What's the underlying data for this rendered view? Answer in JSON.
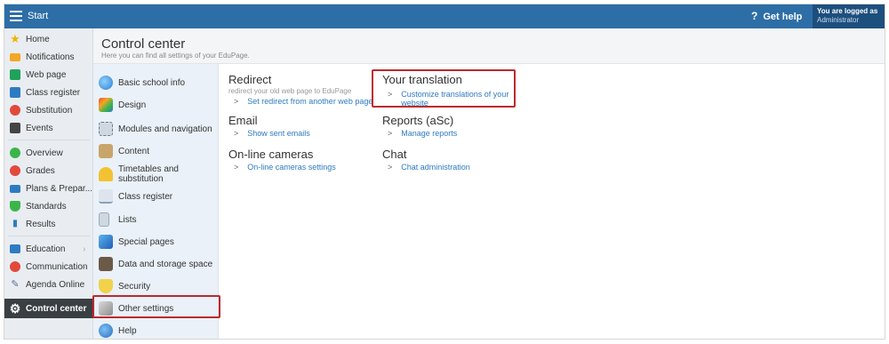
{
  "topbar": {
    "start_label": "Start",
    "help_label": "Get help",
    "help_icon": "?",
    "user_line1": "You are logged as",
    "user_line2": "Administrator"
  },
  "leftnav": {
    "items": [
      {
        "label": "Home",
        "icon": "star-icon",
        "color": "#f0b400"
      },
      {
        "label": "Notifications",
        "icon": "envelope-icon",
        "color": "#f5a623"
      },
      {
        "label": "Web page",
        "icon": "house-icon",
        "color": "#1ea35a"
      },
      {
        "label": "Class register",
        "icon": "book-icon",
        "color": "#2d7cc3"
      },
      {
        "label": "Substitution",
        "icon": "person-icon",
        "color": "#e04a3a"
      },
      {
        "label": "Events",
        "icon": "calendar-icon",
        "color": "#444444"
      },
      {
        "label": "Overview",
        "icon": "circle-icon",
        "color": "#3bb54a"
      },
      {
        "label": "Grades",
        "icon": "circle-icon",
        "color": "#e2493b"
      },
      {
        "label": "Plans & Prepar...",
        "icon": "folder-icon",
        "color": "#2d7cc3"
      },
      {
        "label": "Standards",
        "icon": "shield-icon",
        "color": "#3bb54a"
      },
      {
        "label": "Results",
        "icon": "bar-chart-icon",
        "color": "#2d7cc3"
      },
      {
        "label": "Education",
        "icon": "briefcase-icon",
        "color": "#2d7cc3"
      },
      {
        "label": "Communication",
        "icon": "chat-icon",
        "color": "#e2493b"
      },
      {
        "label": "Agenda Online",
        "icon": "pen-icon",
        "color": "#5a6f9a"
      },
      {
        "label": "Control center",
        "icon": "gear-icon",
        "color": "#ffffff"
      }
    ]
  },
  "header": {
    "title": "Control center",
    "subtitle": "Here you can find all settings of your EduPage."
  },
  "settings": {
    "items": [
      {
        "label": "Basic school info",
        "icon": "globe-icon"
      },
      {
        "label": "Design",
        "icon": "palette-icon"
      },
      {
        "label": "Modules and navigation",
        "icon": "modules-icon"
      },
      {
        "label": "Content",
        "icon": "content-icon"
      },
      {
        "label": "Timetables and substitution",
        "icon": "bell-icon"
      },
      {
        "label": "Class register",
        "icon": "notebook-icon"
      },
      {
        "label": "Lists",
        "icon": "list-icon"
      },
      {
        "label": "Special pages",
        "icon": "cube-icon"
      },
      {
        "label": "Data and storage space",
        "icon": "storage-icon"
      },
      {
        "label": "Security",
        "icon": "lock-icon"
      },
      {
        "label": "Other settings",
        "icon": "tools-icon"
      },
      {
        "label": "Help",
        "icon": "help-icon"
      }
    ]
  },
  "sections": {
    "redirect": {
      "title": "Redirect",
      "desc": "redirect your old web page to EduPage",
      "link": "Set redirect from another web page"
    },
    "email": {
      "title": "Email",
      "link": "Show sent emails"
    },
    "cameras": {
      "title": "On-line cameras",
      "link": "On-line cameras settings"
    },
    "translation": {
      "title": "Your translation",
      "link_line1": "Customize translations of your",
      "link_line2": "website"
    },
    "reports": {
      "title": "Reports (aSc)",
      "link": "Manage reports"
    },
    "chat": {
      "title": "Chat",
      "link": "Chat administration"
    }
  },
  "link_marker": ">",
  "colors": {
    "topbar": "#2d6ea6",
    "active_nav": "#3a3f44",
    "link": "#2f7bc0",
    "highlight": "#c0282d"
  }
}
